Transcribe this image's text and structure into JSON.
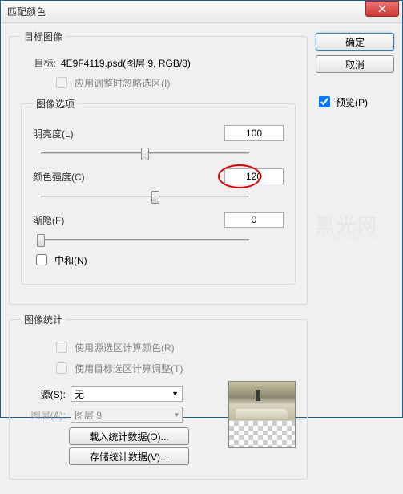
{
  "window": {
    "title": "匹配颜色"
  },
  "buttons": {
    "ok": "确定",
    "cancel": "取消",
    "close_icon": "✕"
  },
  "preview": {
    "checked": true,
    "label": "预览(P)"
  },
  "target_image": {
    "legend": "目标图像",
    "target_label": "目标:",
    "target_value": "4E9F4119.psd(图层 9, RGB/8)",
    "ignore_selection_label": "应用调整时忽略选区(I)",
    "ignore_selection_checked": false
  },
  "image_options": {
    "legend": "图像选项",
    "luminance_label": "明亮度(L)",
    "luminance_value": "100",
    "color_intensity_label": "颜色强度(C)",
    "color_intensity_value": "120",
    "fade_label": "渐隐(F)",
    "fade_value": "0",
    "neutralize_label": "中和(N)",
    "neutralize_checked": false
  },
  "image_stats": {
    "legend": "图像统计",
    "use_source_selection_label": "使用源选区计算颜色(R)",
    "use_target_selection_label": "使用目标选区计算调整(T)",
    "source_label": "源(S):",
    "source_value": "无",
    "layer_label": "图层(A):",
    "layer_value": "图层 9",
    "load_stats_label": "载入统计数据(O)...",
    "save_stats_label": "存储统计数据(V)..."
  }
}
